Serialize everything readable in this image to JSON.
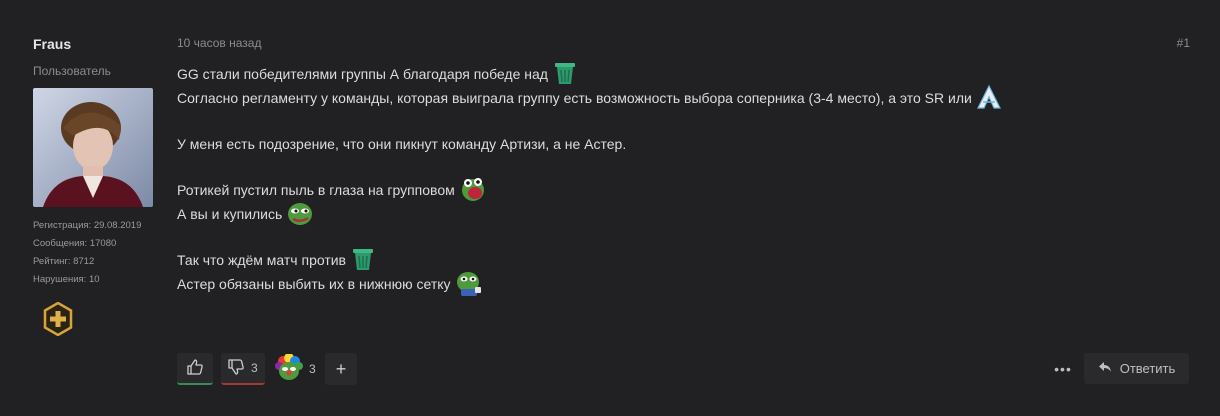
{
  "user": {
    "name": "Fraus",
    "title": "Пользователь",
    "stats": [
      "Регистрация: 29.08.2019",
      "Сообщения: 17080",
      "Рейтинг: 8712",
      "Нарушения: 10"
    ]
  },
  "post": {
    "time": "10 часов назад",
    "number": "#1",
    "lines": [
      "GG стали победителями группы А благодаря победе над",
      "Согласно регламенту у команды, которая выиграла группу есть возможность выбора соперника (3-4 место), а это SR или",
      "У меня есть подозрение, что они пикнут команду Артизи, а не Астер.",
      "Ротикей пустил пыль в глаза на групповом",
      "А вы и купились",
      "Так что ждём матч против",
      "Астер обязаны выбить их в нижнюю сетку"
    ]
  },
  "reactions": {
    "dislike_count": "3",
    "clown_count": "3",
    "add_label": "+"
  },
  "reply_label": "Ответить",
  "colors": {
    "like_accent": "#3c8a5a",
    "dislike_accent": "#a33a3a",
    "emote_trash": "#2c9a6d"
  }
}
